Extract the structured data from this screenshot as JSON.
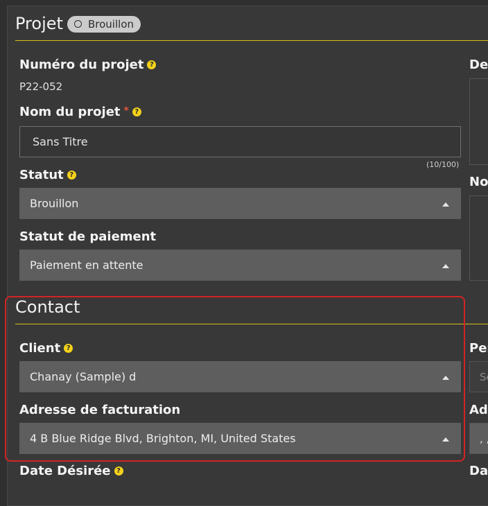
{
  "project": {
    "title": "Projet",
    "badge": "Brouillon",
    "number_label": "Numéro du projet",
    "number_value": "P22-052",
    "name_label": "Nom du projet",
    "required_mark": "*",
    "name_value": "Sans Titre",
    "name_counter": "(10/100)",
    "status_label": "Statut",
    "status_value": "Brouillon",
    "payment_label": "Statut de paiement",
    "payment_value": "Paiement en attente",
    "right_label_1": "Des",
    "right_label_2": "No"
  },
  "contact": {
    "title": "Contact",
    "client_label": "Client",
    "client_value": "Chanay (Sample) d",
    "billing_label": "Adresse de facturation",
    "billing_value": "4 B Blue Ridge Blvd, Brighton, MI, United States",
    "right_label_1": "Per",
    "right_input_placeholder": "Se",
    "right_label_2": "Adr",
    "right_select_value": ", ,"
  },
  "date": {
    "label": "Date Désirée",
    "right_label": "Dat"
  },
  "icons": {
    "help": "help-icon",
    "dropdown": "caret-up-icon",
    "badge": "circle-outline-icon"
  },
  "colors": {
    "accent": "#d8c21a",
    "help": "#f4d21a",
    "highlight": "#d32424",
    "required": "#e0553b"
  }
}
